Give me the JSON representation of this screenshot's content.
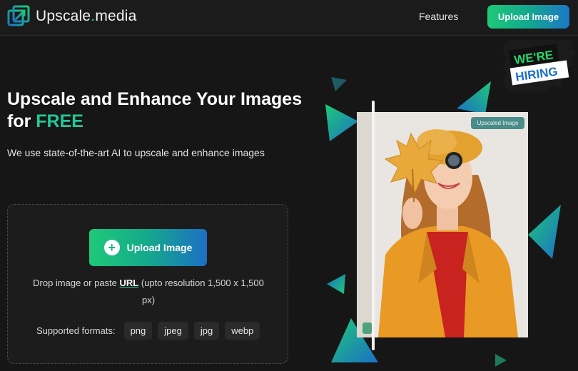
{
  "header": {
    "logo_main": "Upscale",
    "logo_dot": ".",
    "logo_suffix": "media",
    "nav_features": "Features",
    "upload_button": "Upload Image"
  },
  "hero": {
    "title_part1": "Upscale and Enhance Your Images for ",
    "title_free": "FREE",
    "subtitle": "We use state-of-the-art AI to upscale and enhance images"
  },
  "upload": {
    "button_label": "Upload Image",
    "button_icon": "plus-icon",
    "drop_prefix": "Drop image or paste ",
    "drop_url": "URL",
    "drop_suffix": " (upto resolution 1,500 x 1,500 px)",
    "formats_label": "Supported formats:",
    "formats": [
      "png",
      "jpeg",
      "jpg",
      "webp"
    ]
  },
  "preview": {
    "badge": "Upscaled Image",
    "hiring_line1": "WE'RE",
    "hiring_line2": "HIRING"
  },
  "colors": {
    "background": "#161616",
    "accent_green": "#22c998",
    "accent_blue": "#1c77c6"
  }
}
